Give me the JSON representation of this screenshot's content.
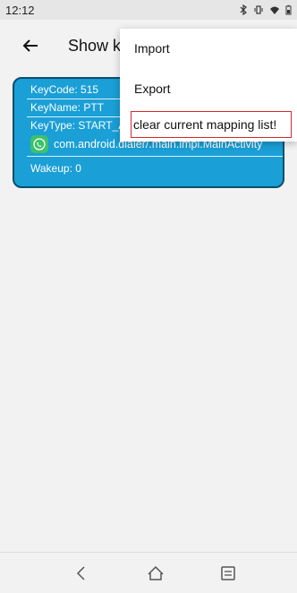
{
  "status_bar": {
    "time": "12:12",
    "icons": [
      "bluetooth-icon",
      "vibrate-icon",
      "wifi-icon",
      "battery-icon"
    ]
  },
  "app_bar": {
    "title": "Show keys mapping",
    "back_icon": "back-arrow-icon"
  },
  "card": {
    "key_code": "KeyCode: 515",
    "key_name": "KeyName: PTT",
    "key_type": "KeyType: START_ACTIVITY",
    "app_icon": "phone-app-icon",
    "activity": "com.android.dialer/.main.impl.MainActivity",
    "wakeup": "Wakeup: 0",
    "color": "#1a9fd6",
    "border_color": "#0b4f6c"
  },
  "menu": {
    "items": [
      {
        "label": "Import"
      },
      {
        "label": "Export"
      },
      {
        "label": "clear current mapping list!"
      }
    ],
    "highlight_color": "#d42a2a"
  },
  "nav_bar": {
    "icons": [
      "back-nav-icon",
      "home-nav-icon",
      "menu-nav-icon"
    ]
  }
}
